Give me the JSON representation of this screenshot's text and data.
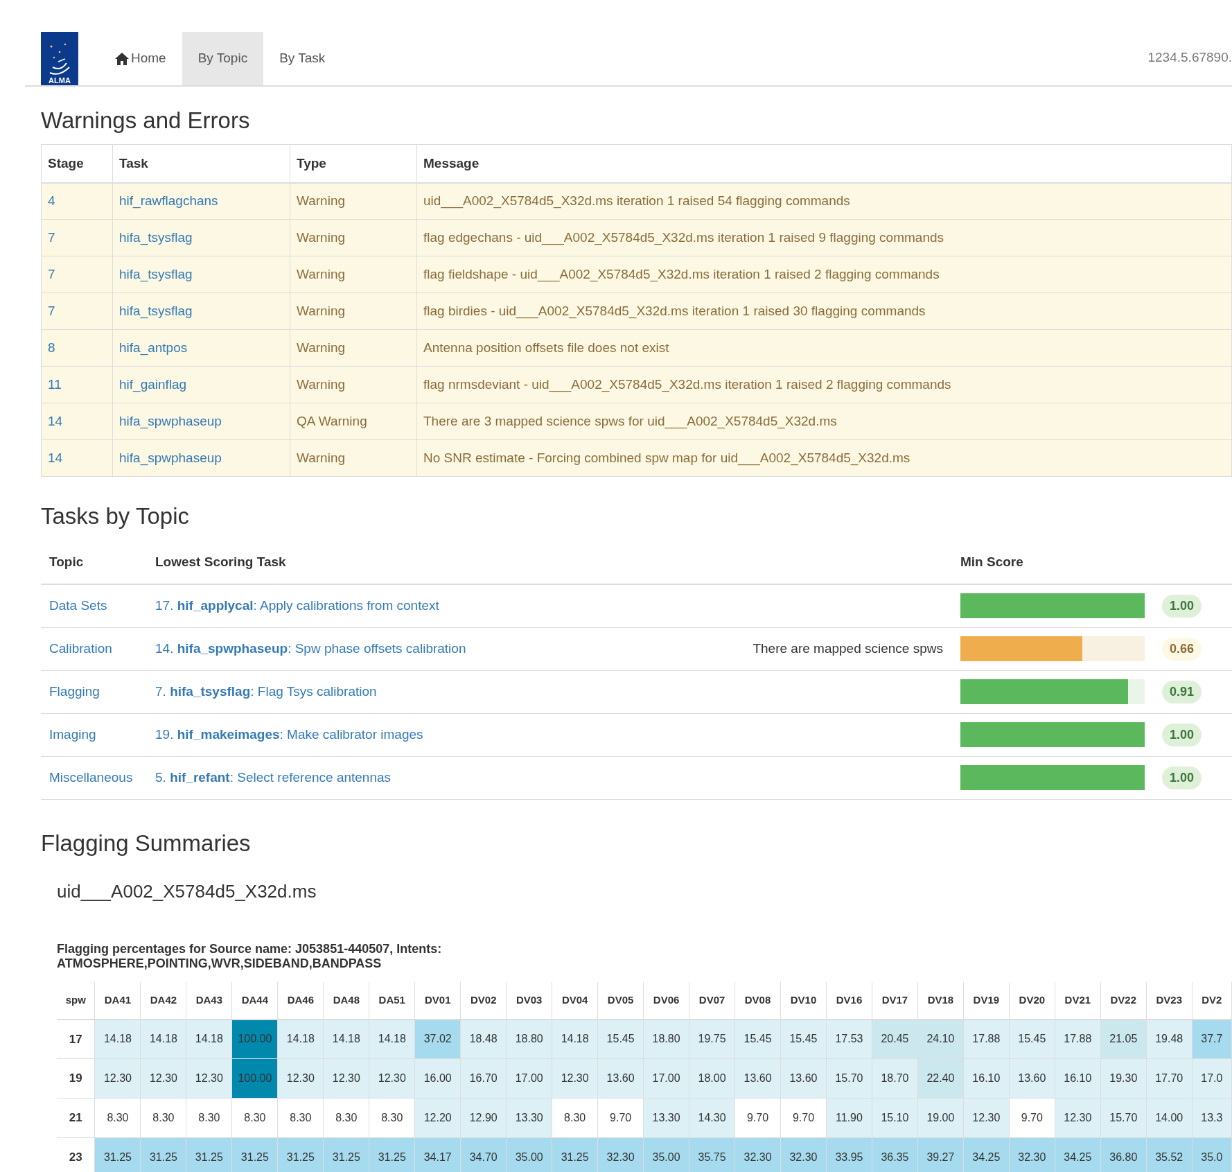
{
  "nav": {
    "logo_text": "ALMA",
    "tabs": [
      {
        "label": "Home",
        "kind": "home",
        "selected": false
      },
      {
        "label": "By Topic",
        "kind": "plain",
        "selected": true
      },
      {
        "label": "By Task",
        "kind": "plain",
        "selected": false
      }
    ],
    "id_text": "1234.5.67890."
  },
  "warnings": {
    "title": "Warnings and Errors",
    "columns": [
      "Stage",
      "Task",
      "Type",
      "Message"
    ],
    "rows": [
      {
        "stage": "4",
        "task": "hif_rawflagchans",
        "type": "Warning",
        "message": "uid___A002_X5784d5_X32d.ms iteration 1 raised 54 flagging commands"
      },
      {
        "stage": "7",
        "task": "hifa_tsysflag",
        "type": "Warning",
        "message": "flag edgechans - uid___A002_X5784d5_X32d.ms iteration 1 raised 9 flagging commands"
      },
      {
        "stage": "7",
        "task": "hifa_tsysflag",
        "type": "Warning",
        "message": "flag fieldshape - uid___A002_X5784d5_X32d.ms iteration 1 raised 2 flagging commands"
      },
      {
        "stage": "7",
        "task": "hifa_tsysflag",
        "type": "Warning",
        "message": "flag birdies - uid___A002_X5784d5_X32d.ms iteration 1 raised 30 flagging commands"
      },
      {
        "stage": "8",
        "task": "hifa_antpos",
        "type": "Warning",
        "message": "Antenna position offsets file does not exist"
      },
      {
        "stage": "11",
        "task": "hif_gainflag",
        "type": "Warning",
        "message": "flag nrmsdeviant - uid___A002_X5784d5_X32d.ms iteration 1 raised 2 flagging commands"
      },
      {
        "stage": "14",
        "task": "hifa_spwphaseup",
        "type": "QA Warning",
        "message": "There are 3 mapped science spws for uid___A002_X5784d5_X32d.ms"
      },
      {
        "stage": "14",
        "task": "hifa_spwphaseup",
        "type": "Warning",
        "message": "No SNR estimate - Forcing combined spw map for uid___A002_X5784d5_X32d.ms"
      }
    ]
  },
  "topics": {
    "title": "Tasks by Topic",
    "columns": [
      "Topic",
      "Lowest Scoring Task",
      "Min Score"
    ],
    "rows": [
      {
        "topic": "Data Sets",
        "task": "17. **hif_applycal**: Apply calibrations from context",
        "kind": "success",
        "level": 1.0,
        "score": "1.00"
      },
      {
        "topic": "Calibration",
        "task": "14. **hifa_spwphaseup**: Spw phase offsets calibration",
        "reason": "There are mapped science spws",
        "kind": "warning",
        "level": 0.66,
        "score": "0.66"
      },
      {
        "topic": "Flagging",
        "task": "7. **hifa_tsysflag**: Flag Tsys calibration",
        "kind": "success",
        "level": 0.91,
        "score": "0.91"
      },
      {
        "topic": "Imaging",
        "task": "19. **hif_makeimages**: Make calibrator images",
        "kind": "success",
        "level": 1.0,
        "score": "1.00"
      },
      {
        "topic": "Miscellaneous",
        "task": "5. **hif_refant**: Select reference antennas",
        "kind": "success",
        "level": 1.0,
        "score": "1.00"
      }
    ]
  },
  "flagging": {
    "title": "Flagging Summaries",
    "ms": "uid___A002_X5784d5_X32d.ms",
    "caption": "Flagging percentages for Source name: J053851-440507, Intents: ATMOSPHERE,POINTING,WVR,SIDEBAND,BANDPASS",
    "row_header_column": "spw",
    "columns": [
      "DA41",
      "DA42",
      "DA43",
      "DA44",
      "DA46",
      "DA48",
      "DA51",
      "DV01",
      "DV02",
      "DV03",
      "DV04",
      "DV05",
      "DV06",
      "DV07",
      "DV08",
      "DV10",
      "DV16",
      "DV17",
      "DV18",
      "DV19",
      "DV20",
      "DV21",
      "DV22",
      "DV23",
      "DV2"
    ],
    "rows": [
      {
        "spw": "17",
        "cells": [
          {
            "value": "14.18",
            "color": "#dcf0f5"
          },
          {
            "value": "14.18",
            "color": "#dcf0f5"
          },
          {
            "value": "14.18",
            "color": "#dcf0f5"
          },
          {
            "value": "100.00",
            "color": "#0088ad"
          },
          {
            "value": "14.18",
            "color": "#dcf0f5"
          },
          {
            "value": "14.18",
            "color": "#dcf0f5"
          },
          {
            "value": "14.18",
            "color": "#dcf0f5"
          },
          {
            "value": "37.02",
            "color": "#a6dbef"
          },
          {
            "value": "18.48",
            "color": "#dcf0f5"
          },
          {
            "value": "18.80",
            "color": "#dcf0f5"
          },
          {
            "value": "14.18",
            "color": "#dcf0f5"
          },
          {
            "value": "15.45",
            "color": "#dcf0f5"
          },
          {
            "value": "18.80",
            "color": "#dcf0f5"
          },
          {
            "value": "19.75",
            "color": "#dcf0f5"
          },
          {
            "value": "15.45",
            "color": "#dcf0f5"
          },
          {
            "value": "15.45",
            "color": "#dcf0f5"
          },
          {
            "value": "17.53",
            "color": "#dcf0f5"
          },
          {
            "value": "20.45",
            "color": "#cbe8ee"
          },
          {
            "value": "24.10",
            "color": "#cbe8ee"
          },
          {
            "value": "17.88",
            "color": "#dcf0f5"
          },
          {
            "value": "15.45",
            "color": "#dcf0f5"
          },
          {
            "value": "17.88",
            "color": "#dcf0f5"
          },
          {
            "value": "21.05",
            "color": "#cbe8ee"
          },
          {
            "value": "19.48",
            "color": "#dcf0f5"
          },
          {
            "value": "37.7",
            "color": "#a6dbef"
          }
        ]
      },
      {
        "spw": "19",
        "cells": [
          {
            "value": "12.30",
            "color": "#dcf0f5"
          },
          {
            "value": "12.30",
            "color": "#dcf0f5"
          },
          {
            "value": "12.30",
            "color": "#dcf0f5"
          },
          {
            "value": "100.00",
            "color": "#0088ad"
          },
          {
            "value": "12.30",
            "color": "#dcf0f5"
          },
          {
            "value": "12.30",
            "color": "#dcf0f5"
          },
          {
            "value": "12.30",
            "color": "#dcf0f5"
          },
          {
            "value": "16.00",
            "color": "#dcf0f5"
          },
          {
            "value": "16.70",
            "color": "#dcf0f5"
          },
          {
            "value": "17.00",
            "color": "#dcf0f5"
          },
          {
            "value": "12.30",
            "color": "#dcf0f5"
          },
          {
            "value": "13.60",
            "color": "#dcf0f5"
          },
          {
            "value": "17.00",
            "color": "#dcf0f5"
          },
          {
            "value": "18.00",
            "color": "#dcf0f5"
          },
          {
            "value": "13.60",
            "color": "#dcf0f5"
          },
          {
            "value": "13.60",
            "color": "#dcf0f5"
          },
          {
            "value": "15.70",
            "color": "#dcf0f5"
          },
          {
            "value": "18.70",
            "color": "#dcf0f5"
          },
          {
            "value": "22.40",
            "color": "#cbe8ee"
          },
          {
            "value": "16.10",
            "color": "#dcf0f5"
          },
          {
            "value": "13.60",
            "color": "#dcf0f5"
          },
          {
            "value": "16.10",
            "color": "#dcf0f5"
          },
          {
            "value": "19.30",
            "color": "#dcf0f5"
          },
          {
            "value": "17.70",
            "color": "#dcf0f5"
          },
          {
            "value": "17.0",
            "color": "#dcf0f5"
          }
        ]
      },
      {
        "spw": "21",
        "cells": [
          {
            "value": "8.30",
            "color": "#ffffff"
          },
          {
            "value": "8.30",
            "color": "#ffffff"
          },
          {
            "value": "8.30",
            "color": "#ffffff"
          },
          {
            "value": "8.30",
            "color": "#ffffff"
          },
          {
            "value": "8.30",
            "color": "#ffffff"
          },
          {
            "value": "8.30",
            "color": "#ffffff"
          },
          {
            "value": "8.30",
            "color": "#ffffff"
          },
          {
            "value": "12.20",
            "color": "#dcf0f5"
          },
          {
            "value": "12.90",
            "color": "#dcf0f5"
          },
          {
            "value": "13.30",
            "color": "#dcf0f5"
          },
          {
            "value": "8.30",
            "color": "#ffffff"
          },
          {
            "value": "9.70",
            "color": "#ffffff"
          },
          {
            "value": "13.30",
            "color": "#dcf0f5"
          },
          {
            "value": "14.30",
            "color": "#dcf0f5"
          },
          {
            "value": "9.70",
            "color": "#ffffff"
          },
          {
            "value": "9.70",
            "color": "#ffffff"
          },
          {
            "value": "11.90",
            "color": "#dcf0f5"
          },
          {
            "value": "15.10",
            "color": "#dcf0f5"
          },
          {
            "value": "19.00",
            "color": "#dcf0f5"
          },
          {
            "value": "12.30",
            "color": "#dcf0f5"
          },
          {
            "value": "9.70",
            "color": "#ffffff"
          },
          {
            "value": "12.30",
            "color": "#dcf0f5"
          },
          {
            "value": "15.70",
            "color": "#dcf0f5"
          },
          {
            "value": "14.00",
            "color": "#dcf0f5"
          },
          {
            "value": "13.3",
            "color": "#dcf0f5"
          }
        ]
      },
      {
        "spw": "23",
        "cells": [
          {
            "value": "31.25",
            "color": "#a6dbef"
          },
          {
            "value": "31.25",
            "color": "#a6dbef"
          },
          {
            "value": "31.25",
            "color": "#a6dbef"
          },
          {
            "value": "31.25",
            "color": "#a6dbef"
          },
          {
            "value": "31.25",
            "color": "#a6dbef"
          },
          {
            "value": "31.25",
            "color": "#a6dbef"
          },
          {
            "value": "31.25",
            "color": "#a6dbef"
          },
          {
            "value": "34.17",
            "color": "#a6dbef"
          },
          {
            "value": "34.70",
            "color": "#a6dbef"
          },
          {
            "value": "35.00",
            "color": "#a6dbef"
          },
          {
            "value": "31.25",
            "color": "#a6dbef"
          },
          {
            "value": "32.30",
            "color": "#a6dbef"
          },
          {
            "value": "35.00",
            "color": "#a6dbef"
          },
          {
            "value": "35.75",
            "color": "#a6dbef"
          },
          {
            "value": "32.30",
            "color": "#a6dbef"
          },
          {
            "value": "32.30",
            "color": "#a6dbef"
          },
          {
            "value": "33.95",
            "color": "#a6dbef"
          },
          {
            "value": "36.35",
            "color": "#a6dbef"
          },
          {
            "value": "39.27",
            "color": "#a6dbef"
          },
          {
            "value": "34.25",
            "color": "#a6dbef"
          },
          {
            "value": "32.30",
            "color": "#a6dbef"
          },
          {
            "value": "34.25",
            "color": "#a6dbef"
          },
          {
            "value": "36.80",
            "color": "#a6dbef"
          },
          {
            "value": "35.52",
            "color": "#a6dbef"
          },
          {
            "value": "35.0",
            "color": "#a6dbef"
          }
        ]
      }
    ]
  }
}
